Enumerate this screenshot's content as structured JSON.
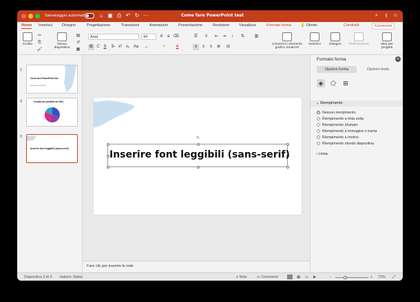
{
  "titlebar": {
    "autosave_label": "Salvataggio automatico",
    "toggle_state": "OFF",
    "window_title": "Come fare PowerPoint test",
    "icons": [
      "home-icon",
      "save-icon",
      "print-icon",
      "undo-icon",
      "redo-icon",
      "more-icon",
      "search-icon",
      "share-icon",
      "user-icon"
    ]
  },
  "tabs": {
    "items": [
      "Home",
      "Inserisci",
      "Disegno",
      "Progettazione",
      "Transizioni",
      "Animazioni",
      "Presentazione",
      "Revisione",
      "Visualizza",
      "Formato forma"
    ],
    "active": "Home",
    "tell_me": "Dimmi",
    "share_label": "Condividi",
    "comments_label": "Commenti"
  },
  "ribbon": {
    "paste_label": "Incolla",
    "new_slide_label": "Nuova diapositiva",
    "font_name": "Arial",
    "font_size": "44",
    "convert_smartart_label": "Converti in elemento grafico SmartArt",
    "insert_label": "Inserisci",
    "draw_label": "Disegno",
    "resize_label": "Ridimensiona",
    "ideas_label": "Idee per progetti",
    "format_buttons": [
      "G",
      "C",
      "S"
    ]
  },
  "thumbnails": [
    {
      "number": "1",
      "title": "Come fare PowerPoint test",
      "subtitle": "Salvatore Aranzulla"
    },
    {
      "number": "2",
      "title": "Vendite dei prodotti nel 2021"
    },
    {
      "number": "3",
      "title": "Inserire font leggibili (sans-serif)"
    }
  ],
  "slide": {
    "title": "Inserire font leggibili (sans-serif)"
  },
  "notes": {
    "placeholder": "Fare clic per inserire le note"
  },
  "format_pane": {
    "title": "Formato forma",
    "tabs": [
      "Opzioni forma",
      "Opzioni testo"
    ],
    "active_tab": "Opzioni forma",
    "fill_section": "Riempimento",
    "fill_options": [
      "Nessun riempimento",
      "Riempimento a tinta unita",
      "Riempimento sfumato",
      "Riempimento a immagine o trama",
      "Riempimento a motivo",
      "Riempimento sfondo diapositiva"
    ],
    "selected_fill": "Nessun riempimento",
    "line_section": "Linea"
  },
  "statusbar": {
    "slide_info": "Diapositiva 3 di 3",
    "language": "Italiano (Italia)",
    "notes_label": "Note",
    "comments_label": "Commenti",
    "zoom": "72%"
  },
  "colors": {
    "accent": "#c43e1c",
    "swash": "#c9dff0",
    "pie": [
      "#e0287a",
      "#3a4fc4",
      "#8a3fb5",
      "#2aa3c9"
    ]
  }
}
